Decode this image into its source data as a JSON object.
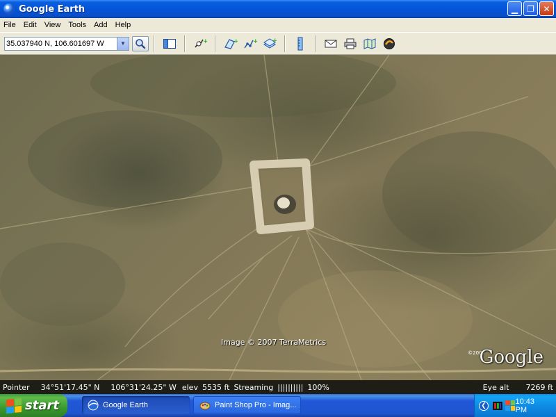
{
  "window": {
    "title": "Google Earth"
  },
  "menubar": {
    "items": [
      "File",
      "Edit",
      "View",
      "Tools",
      "Add",
      "Help"
    ]
  },
  "toolbar": {
    "search_value": "35.037940 N, 106.601697 W",
    "icons": [
      "sidebar-icon",
      "placemark-icon",
      "polygon-icon",
      "path-icon",
      "overlay-icon",
      "ruler-icon",
      "email-icon",
      "print-icon",
      "maps-icon",
      "sky-icon"
    ]
  },
  "map": {
    "attribution": "Image © 2007 TerraMetrics",
    "watermark": "Google",
    "watermark_year": "©2007"
  },
  "status": {
    "pointer_label": "Pointer",
    "lat": "34°51'17.45\" N",
    "lon": "106°31'24.25\" W",
    "elev_label": "elev",
    "elev": "5535 ft",
    "streaming_label": "Streaming",
    "streaming_bars": "||||||||||",
    "streaming_pct": "100%",
    "eye_alt_label": "Eye alt",
    "eye_alt": "7269 ft"
  },
  "taskbar": {
    "start_label": "start",
    "tasks": [
      {
        "label": "Google Earth",
        "active": true
      },
      {
        "label": "Paint Shop Pro - Imag...",
        "active": false
      }
    ],
    "clock": "10:43 PM"
  }
}
